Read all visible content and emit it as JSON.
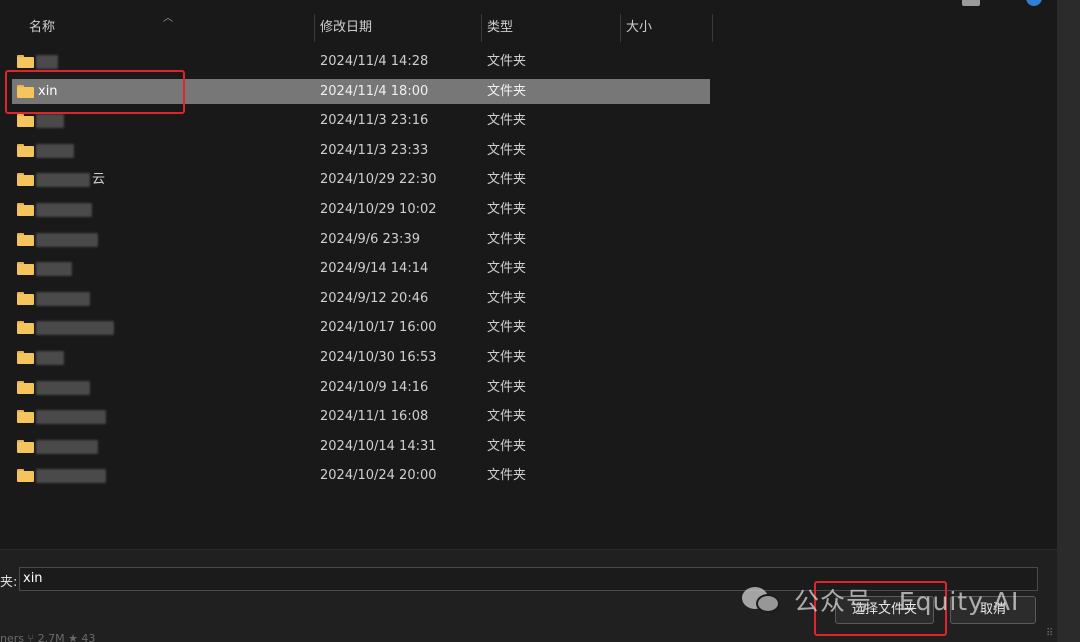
{
  "header": {
    "name": "名称",
    "modified": "修改日期",
    "type": "类型",
    "size": "大小"
  },
  "rows": [
    {
      "name": "",
      "suffix": "",
      "date": "2024/11/4 14:28",
      "type": "文件夹",
      "selected": false
    },
    {
      "name": "xin",
      "suffix": "",
      "date": "2024/11/4 18:00",
      "type": "文件夹",
      "selected": true
    },
    {
      "name": "",
      "suffix": "",
      "date": "2024/11/3 23:16",
      "type": "文件夹",
      "selected": false
    },
    {
      "name": "",
      "suffix": "",
      "date": "2024/11/3 23:33",
      "type": "文件夹",
      "selected": false
    },
    {
      "name": "",
      "suffix": "云",
      "date": "2024/10/29 22:30",
      "type": "文件夹",
      "selected": false
    },
    {
      "name": "",
      "suffix": "",
      "date": "2024/10/29 10:02",
      "type": "文件夹",
      "selected": false
    },
    {
      "name": "",
      "suffix": "",
      "date": "2024/9/6 23:39",
      "type": "文件夹",
      "selected": false
    },
    {
      "name": "",
      "suffix": "",
      "date": "2024/9/14 14:14",
      "type": "文件夹",
      "selected": false
    },
    {
      "name": "",
      "suffix": "",
      "date": "2024/9/12 20:46",
      "type": "文件夹",
      "selected": false
    },
    {
      "name": "",
      "suffix": "",
      "date": "2024/10/17 16:00",
      "type": "文件夹",
      "selected": false
    },
    {
      "name": "",
      "suffix": "",
      "date": "2024/10/30 16:53",
      "type": "文件夹",
      "selected": false
    },
    {
      "name": "",
      "suffix": "",
      "date": "2024/10/9 14:16",
      "type": "文件夹",
      "selected": false
    },
    {
      "name": "",
      "suffix": "",
      "date": "2024/11/1 16:08",
      "type": "文件夹",
      "selected": false
    },
    {
      "name": "",
      "suffix": "",
      "date": "2024/10/14 14:31",
      "type": "文件夹",
      "selected": false
    },
    {
      "name": "",
      "suffix": "",
      "date": "2024/10/24 20:00",
      "type": "文件夹",
      "selected": false
    }
  ],
  "footer": {
    "folder_label": "夹:",
    "folder_value": "xin",
    "select_button": "选择文件夹",
    "cancel_button": "取消"
  },
  "watermark": {
    "text": "公众号 · Equity AI"
  },
  "taskbar_text": "ners   ⑂ 2.7M ★ 43",
  "colors": {
    "selected_row": "#777777",
    "highlight": "#e0242b",
    "folder": "#f3c55c"
  }
}
